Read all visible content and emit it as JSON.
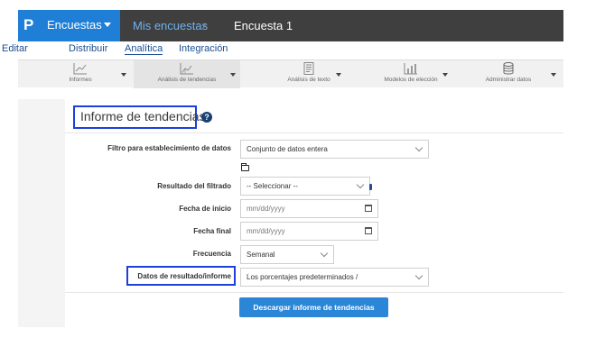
{
  "topbar": {
    "logo": "P",
    "product": "Encuestas",
    "breadcrumb_parent": "Mis encuestas",
    "breadcrumb_sep": "›",
    "breadcrumb_current": "Encuesta 1"
  },
  "menu": {
    "items": [
      "Editar",
      "Distribuir",
      "Analítica",
      "Integración"
    ],
    "active": "Analítica"
  },
  "toolbar": {
    "items": [
      {
        "label": "Informes",
        "icon": "chart-line-icon"
      },
      {
        "label": "Análisis de tendencias",
        "icon": "trend-chart-icon"
      },
      {
        "label": "Análisis de texto",
        "icon": "document-icon"
      },
      {
        "label": "Modelos de elección",
        "icon": "bar-chart-icon"
      },
      {
        "label": "Administrar datos",
        "icon": "database-icon"
      }
    ],
    "selected": "Análisis de tendencias"
  },
  "form": {
    "title": "Informe de tendencias",
    "help": "?",
    "filter_label": "Filtro para establecimiento de datos",
    "filter_value": "Conjunto de datos entera",
    "result_label": "Resultado del filtrado",
    "result_value": "-- Seleccionar --",
    "start_label": "Fecha de inicio",
    "start_placeholder": "mm/dd/yyyy",
    "end_label": "Fecha final",
    "end_placeholder": "mm/dd/yyyy",
    "freq_label": "Frecuencia",
    "freq_value": "Semanal",
    "data_label": "Datos de resultado/informe",
    "data_value": "Los porcentajes predeterminados /",
    "download_button": "Descargar informe de tendencias"
  },
  "colors": {
    "brand": "#1f7fd6",
    "topbar": "#3f3f3f",
    "highlight": "#1e3fd8",
    "button": "#2b86d8"
  }
}
